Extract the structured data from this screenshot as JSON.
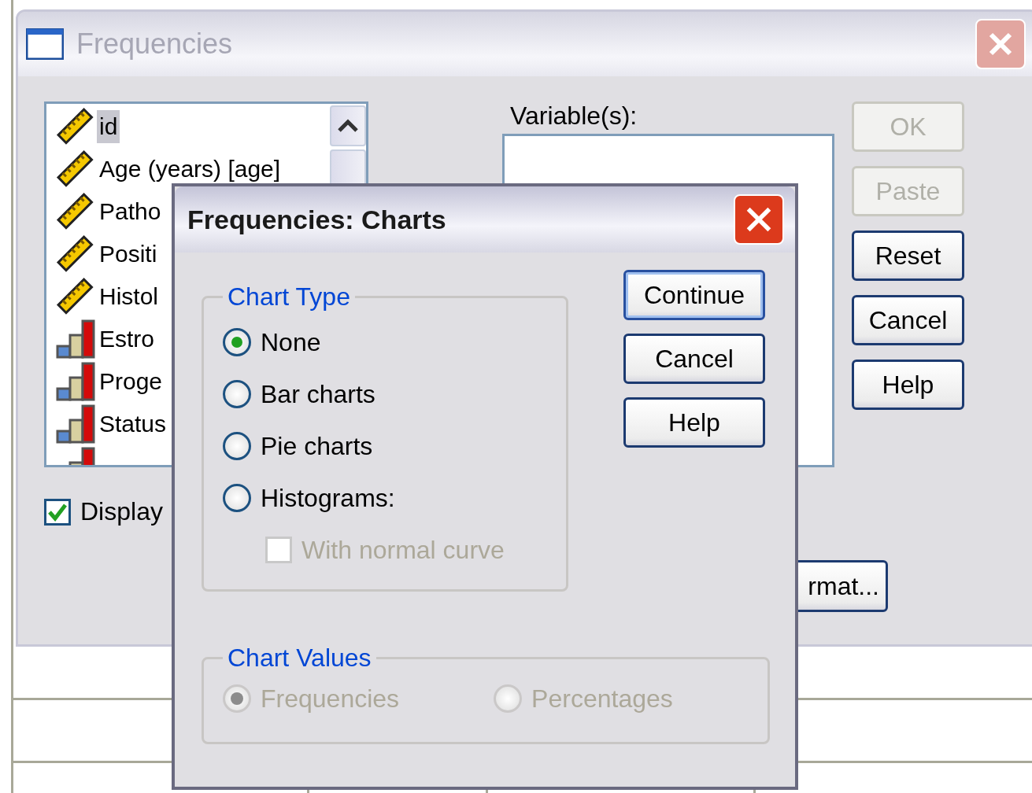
{
  "main_window": {
    "title": "Frequencies",
    "variables": [
      {
        "name": "id",
        "kind": "scale",
        "selected": true
      },
      {
        "name": "Age (years) [age]",
        "kind": "scale",
        "selected": false
      },
      {
        "name": "Patho",
        "kind": "scale",
        "selected": false
      },
      {
        "name": "Positi",
        "kind": "scale",
        "selected": false
      },
      {
        "name": "Histol",
        "kind": "scale",
        "selected": false
      },
      {
        "name": "Estro",
        "kind": "nominal",
        "selected": false
      },
      {
        "name": "Proge",
        "kind": "nominal",
        "selected": false
      },
      {
        "name": "Status",
        "kind": "nominal",
        "selected": false
      },
      {
        "kind": "nominal"
      }
    ],
    "variables_label": "Variable(s):",
    "buttons": [
      {
        "label": "OK",
        "disabled": true
      },
      {
        "label": "Paste",
        "disabled": true
      },
      {
        "label": "Reset",
        "disabled": false
      },
      {
        "label": "Cancel",
        "disabled": false
      },
      {
        "label": "Help",
        "disabled": false
      }
    ],
    "display_checkbox": {
      "label": "Display",
      "checked": true
    },
    "format_button": "rmat..."
  },
  "charts_dialog": {
    "title": "Frequencies: Charts",
    "chart_type": {
      "legend": "Chart Type",
      "options": [
        {
          "label": "None",
          "selected": true
        },
        {
          "label": "Bar charts",
          "selected": false
        },
        {
          "label": "Pie charts",
          "selected": false
        },
        {
          "label": "Histograms:",
          "selected": false
        }
      ],
      "normal_curve": {
        "label": "With normal curve",
        "checked": false,
        "disabled": true
      }
    },
    "buttons": [
      {
        "label": "Continue",
        "default": true
      },
      {
        "label": "Cancel",
        "default": false
      },
      {
        "label": "Help",
        "default": false
      }
    ],
    "chart_values": {
      "legend": "Chart Values",
      "disabled": true,
      "options": [
        {
          "label": "Frequencies",
          "selected": true
        },
        {
          "label": "Percentages",
          "selected": false
        }
      ]
    }
  }
}
